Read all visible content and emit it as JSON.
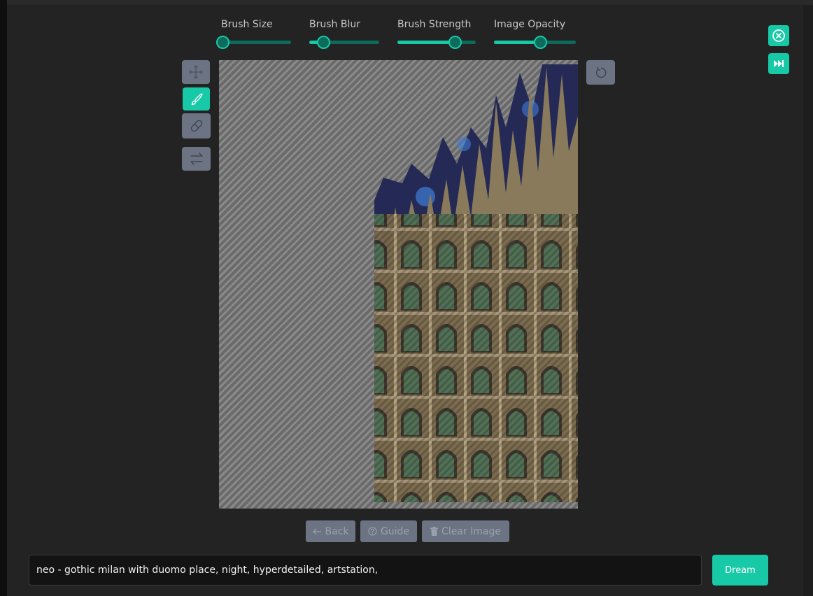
{
  "sliders": [
    {
      "label": "Brush Size",
      "value": 0.02
    },
    {
      "label": "Brush Blur",
      "value": 0.2
    },
    {
      "label": "Brush Strength",
      "value": 0.73
    },
    {
      "label": "Image Opacity",
      "value": 0.56
    }
  ],
  "tools": {
    "move": "move-icon",
    "brush": "brush-icon",
    "eraser": "eraser-icon",
    "swap": "swap-icon",
    "active": "brush"
  },
  "buttons": {
    "back": {
      "label": "Back",
      "icon": "arrow-left-icon"
    },
    "guide": {
      "label": "Guide",
      "icon": "help-circle-icon"
    },
    "clear": {
      "label": "Clear Image",
      "icon": "trash-icon"
    },
    "dream": "Dream",
    "reset": "rotate-ccw-icon",
    "close": "close-circle-icon",
    "skip": "skip-forward-icon"
  },
  "prompt": {
    "value": "neo - gothic milan with duomo place, night, hyperdetailed, artstation,"
  },
  "colors": {
    "accent": "#17c9a6",
    "accent_dark": "#0d6b5b",
    "tool_bg": "#6c7483",
    "panel_bg": "#232323"
  }
}
